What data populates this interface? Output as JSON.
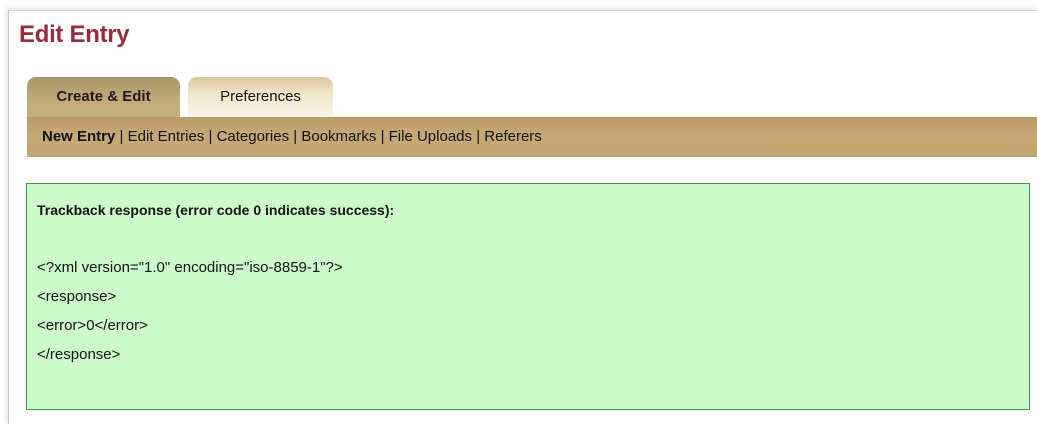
{
  "header": {
    "title": "Edit Entry"
  },
  "tabs": [
    {
      "label": "Create & Edit",
      "active": true
    },
    {
      "label": "Preferences",
      "active": false
    }
  ],
  "subnav": {
    "items": [
      "New Entry",
      "Edit Entries",
      "Categories",
      "Bookmarks",
      "File Uploads",
      "Referers"
    ],
    "current": "New Entry",
    "separator": "|"
  },
  "response": {
    "heading": "Trackback response (error code 0 indicates success):",
    "lines": [
      "<?xml version=\"1.0\" encoding=\"iso-8859-1\"?>",
      "<response>",
      "<error>0</error>",
      "</response>"
    ]
  },
  "colors": {
    "title": "#9a2a3c",
    "subnav_bg": "#c6a976",
    "active_tab": "#c2ab78",
    "inactive_tab": "#f3e6c9",
    "success_bg": "#cdfccb",
    "success_border": "#3b9a3f"
  }
}
